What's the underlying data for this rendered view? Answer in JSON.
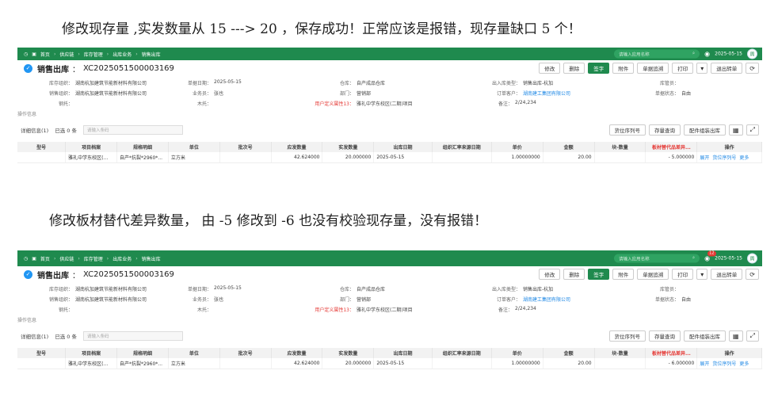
{
  "notes": {
    "top": "修改现存量 ,实发数量从 15 ---> 20 ，保存成功！正常应该是报错，现存量缺口 5 个！",
    "middle": "修改板材替代差异数量， 由 -5 修改到 -6 也没有校验现存量，没有报错！"
  },
  "screens": [
    {
      "nav": {
        "crumbs": [
          "首页",
          "供应链",
          "库存管理",
          "出库业务",
          "销售出库"
        ],
        "search_placeholder": "请输入应用名称",
        "notification_count": "",
        "date": "2025-05-15",
        "avatar": "周"
      },
      "header": {
        "title": "销售出库",
        "code": "XC2025051500003169",
        "buttons": [
          "修改",
          "删除",
          "签字",
          "附件",
          "单据追溯",
          "打印",
          "退出转单"
        ]
      },
      "form": {
        "row1": [
          {
            "label": "库存组织：",
            "value": "湖南杭加建筑节能新材料有限公司"
          },
          {
            "label": "单据日期：",
            "value": "2025-05-15"
          },
          {
            "label": "仓库：",
            "value": "自产成品仓库"
          },
          {
            "label": "出入库类型：",
            "value": "销售出库-杭加"
          },
          {
            "label": "库管员：",
            "value": ""
          }
        ],
        "row2": [
          {
            "label": "销售组织：",
            "value": "湖南杭加建筑节能新材料有限公司"
          },
          {
            "label": "业务员：",
            "value": "张也"
          },
          {
            "label": "部门：",
            "value": "营销部"
          },
          {
            "label": "订单客户：",
            "value": "湖南建工集团有限公司"
          },
          {
            "label": "单据状态：",
            "value": "自由"
          }
        ],
        "row3": [
          {
            "label": "钢托：",
            "value": ""
          },
          {
            "label": "木托：",
            "value": ""
          },
          {
            "label": "用户定义属性13：",
            "value": "雅礼中学东校区(二期)项目"
          },
          {
            "label": "备注：",
            "value": "2/24,234"
          }
        ],
        "section": "操作信息"
      },
      "detail": {
        "label": "详细信息(1)",
        "selected": "已选 0 条",
        "filter_placeholder": "请输入条码",
        "buttons": [
          "货位序列号",
          "存量查询",
          "配件组装出库"
        ]
      },
      "table": {
        "columns": [
          "型号",
          "项目档案",
          "规格明细",
          "单位",
          "批次号",
          "应发数量",
          "实发数量",
          "出库日期",
          "组织汇率来源日期",
          "单价",
          "金额",
          "块-数量",
          "板材替代品差异...",
          "操作"
        ],
        "row": [
          "",
          "雅礼中学东校区(...",
          "自产*抗裂*2960*...",
          "立方米",
          "",
          "42.624000",
          "20.000000",
          "2025-05-15",
          "",
          "1.00000000",
          "20.00",
          "",
          "- 5.000000",
          ""
        ],
        "ops": [
          "展开",
          "货位序列号",
          "更多"
        ]
      }
    },
    {
      "nav": {
        "crumbs": [
          "首页",
          "供应链",
          "库存管理",
          "出库业务",
          "销售出库"
        ],
        "search_placeholder": "请输入应用名称",
        "notification_count": "12",
        "date": "2025-05-15",
        "avatar": "周"
      },
      "header": {
        "title": "销售出库",
        "code": "XC2025051500003169",
        "buttons": [
          "修改",
          "删除",
          "签字",
          "附件",
          "单据追溯",
          "打印",
          "退出转单"
        ]
      },
      "form": {
        "row1": [
          {
            "label": "库存组织：",
            "value": "湖南杭加建筑节能新材料有限公司"
          },
          {
            "label": "单据日期：",
            "value": "2025-05-15"
          },
          {
            "label": "仓库：",
            "value": "自产成品仓库"
          },
          {
            "label": "出入库类型：",
            "value": "销售出库-杭加"
          },
          {
            "label": "库管员：",
            "value": ""
          }
        ],
        "row2": [
          {
            "label": "销售组织：",
            "value": "湖南杭加建筑节能新材料有限公司"
          },
          {
            "label": "业务员：",
            "value": "张也"
          },
          {
            "label": "部门：",
            "value": "营销部"
          },
          {
            "label": "订单客户：",
            "value": "湖南建工集团有限公司"
          },
          {
            "label": "单据状态：",
            "value": "自由"
          }
        ],
        "row3": [
          {
            "label": "钢托：",
            "value": ""
          },
          {
            "label": "木托：",
            "value": ""
          },
          {
            "label": "用户定义属性13：",
            "value": "雅礼中学东校区(二期)项目"
          },
          {
            "label": "备注：",
            "value": "2/24,234"
          }
        ],
        "section": "操作信息"
      },
      "detail": {
        "label": "详细信息(1)",
        "selected": "已选 0 条",
        "filter_placeholder": "请输入条码",
        "buttons": [
          "货位序列号",
          "存量查询",
          "配件组装出库"
        ]
      },
      "table": {
        "columns": [
          "型号",
          "项目档案",
          "规格明细",
          "单位",
          "批次号",
          "应发数量",
          "实发数量",
          "出库日期",
          "组织汇率来源日期",
          "单价",
          "金额",
          "块-数量",
          "板材替代品差异...",
          "操作"
        ],
        "row": [
          "",
          "雅礼中学东校区(...",
          "自产*抗裂*2960*...",
          "立方米",
          "",
          "42.624000",
          "20.000000",
          "2025-05-15",
          "",
          "1.00000000",
          "20.00",
          "",
          "- 6.000000",
          ""
        ],
        "ops": [
          "展开",
          "货位序列号",
          "更多"
        ]
      }
    }
  ],
  "colors": {
    "brand": "#1f8a4e",
    "highlight": "#e53935",
    "link": "#1e88e5"
  }
}
